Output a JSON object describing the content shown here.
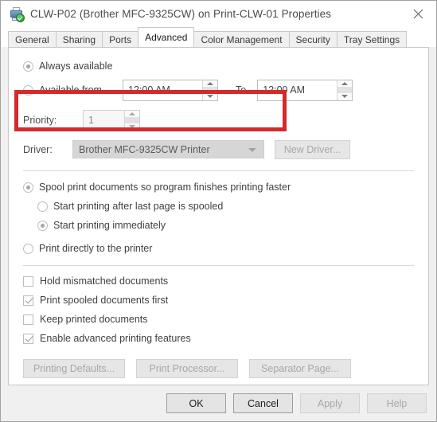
{
  "window": {
    "title": "CLW-P02 (Brother MFC-9325CW) on Print-CLW-01 Properties",
    "icon": "printer-check-icon",
    "close_label": "close-icon"
  },
  "tabs": [
    {
      "label": "General",
      "active": false
    },
    {
      "label": "Sharing",
      "active": false
    },
    {
      "label": "Ports",
      "active": false
    },
    {
      "label": "Advanced",
      "active": true
    },
    {
      "label": "Color Management",
      "active": false
    },
    {
      "label": "Security",
      "active": false
    },
    {
      "label": "Tray Settings",
      "active": false
    }
  ],
  "availability": {
    "always_available_label": "Always available",
    "always_available_selected": true,
    "available_from_label": "Available from",
    "available_from_selected": false,
    "from_time": "12:00 AM",
    "to_label": "To",
    "to_time": "12:00 AM"
  },
  "priority": {
    "label": "Priority:",
    "value": "1"
  },
  "driver": {
    "label": "Driver:",
    "value": "Brother MFC-9325CW Printer",
    "new_driver_label": "New Driver..."
  },
  "spooling": {
    "spool_label": "Spool print documents so program finishes printing faster",
    "spool_selected": true,
    "after_last_page_label": "Start printing after last page is spooled",
    "after_last_page_selected": false,
    "immediately_label": "Start printing immediately",
    "immediately_selected": true,
    "direct_label": "Print directly to the printer",
    "direct_selected": false
  },
  "options": [
    {
      "label": "Hold mismatched documents",
      "checked": false
    },
    {
      "label": "Print spooled documents first",
      "checked": true
    },
    {
      "label": "Keep printed documents",
      "checked": false
    },
    {
      "label": "Enable advanced printing features",
      "checked": true
    }
  ],
  "action_buttons": [
    {
      "label": "Printing Defaults...",
      "enabled": false
    },
    {
      "label": "Print Processor...",
      "enabled": false
    },
    {
      "label": "Separator Page...",
      "enabled": false
    }
  ],
  "footer_buttons": [
    {
      "label": "OK",
      "enabled": true
    },
    {
      "label": "Cancel",
      "enabled": true
    },
    {
      "label": "Apply",
      "enabled": false
    },
    {
      "label": "Help",
      "enabled": false
    }
  ],
  "annotation": {
    "color": "#d42a2a",
    "shape": "rectangle-highlight"
  }
}
